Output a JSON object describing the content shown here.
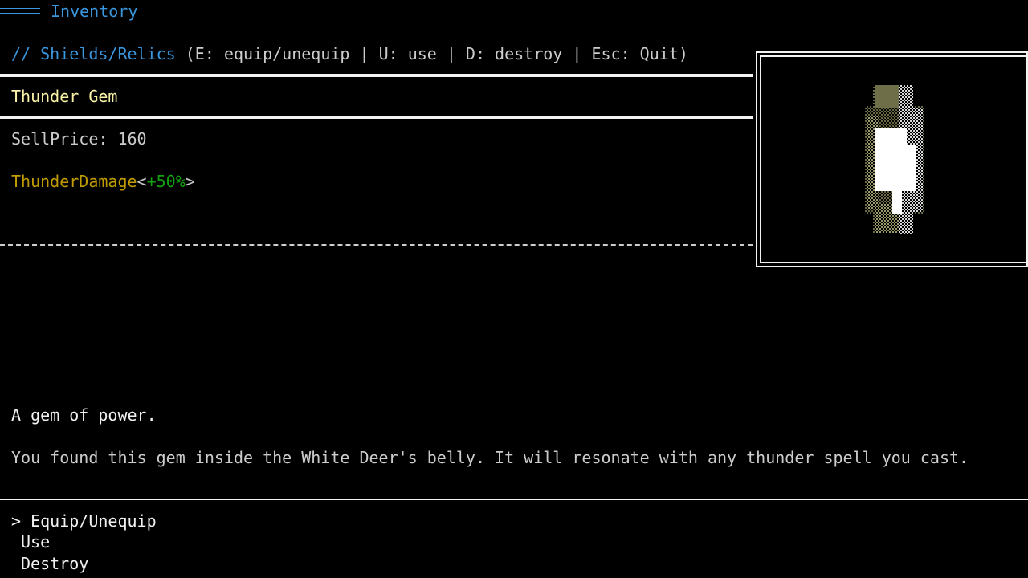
{
  "header": {
    "title": "Inventory"
  },
  "category": {
    "prefix": "// Shields/Relics",
    "controls": " (E: equip/unequip | U: use | D: destroy | Esc: Quit)"
  },
  "item": {
    "name": "Thunder Gem",
    "sell_price": "SellPrice: 160",
    "stat_name": "ThunderDamage",
    "stat_open": "<",
    "stat_value": "+50%",
    "stat_close": ">"
  },
  "description": {
    "short": "A gem of power.",
    "long": "You found this gem inside the White Deer's belly. It will resonate with any thunder spell you cast."
  },
  "menu": {
    "items": [
      {
        "label": "> Equip/Unequip"
      },
      {
        "label": "Use"
      },
      {
        "label": "Destroy"
      }
    ]
  },
  "preview": {
    "icon": "thunder-gem-sprite",
    "colors": {
      "gem": "#ffffff",
      "glow": "#8a8a5a",
      "shade": "#c8c8c8"
    }
  }
}
